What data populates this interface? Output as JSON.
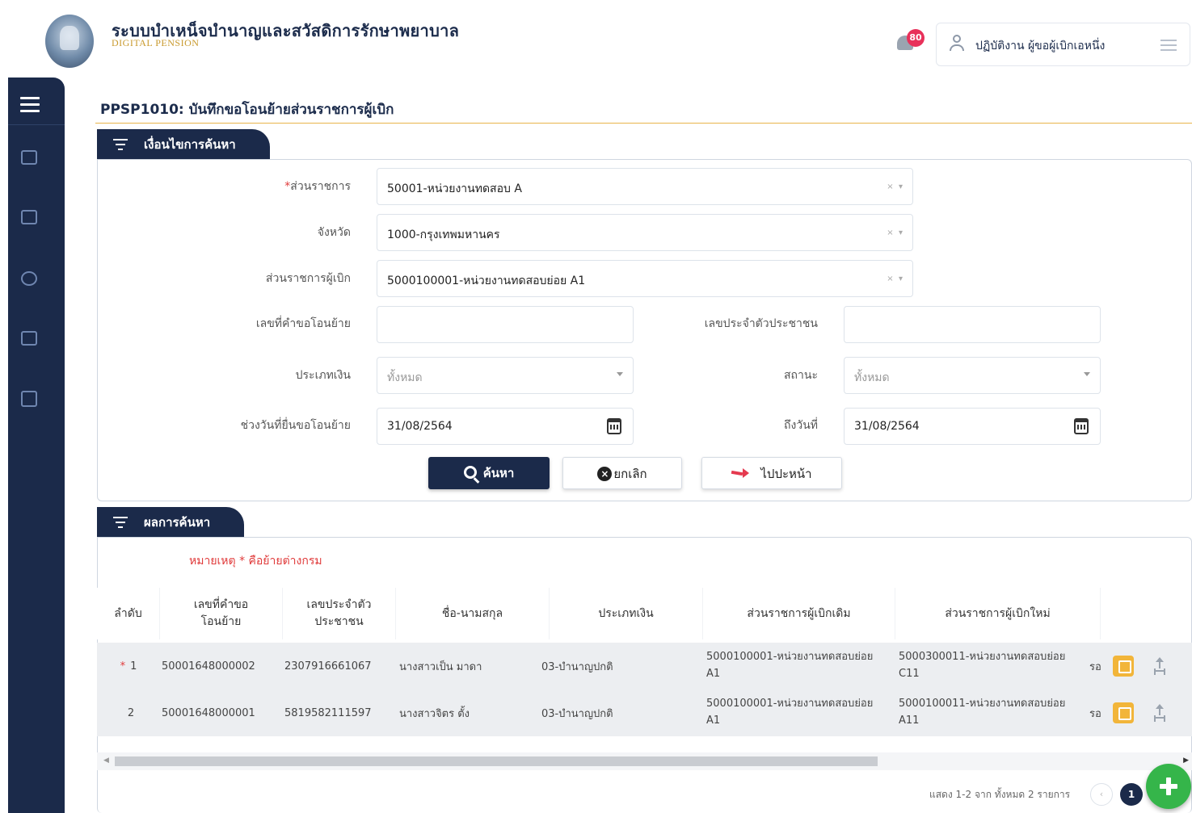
{
  "header": {
    "app_title": "ระบบบำเหน็จบำนาญและสวัสดิการรักษาพยาบาล",
    "app_subtitle": "DIGITAL PENSION",
    "notification_count": "80",
    "user_label": "ปฏิบัติงาน ผู้ขอผู้เบิกเอหนึ่ง"
  },
  "page": {
    "title": "PPSP1010: บันทึกขอโอนย้ายส่วนราชการผู้เบิก"
  },
  "search_section": {
    "title": "เงื่อนไขการค้นหา",
    "fields": {
      "agency": {
        "label": "ส่วนราชการ",
        "required_mark": "*",
        "value": "50001-หน่วยงานทดสอบ A"
      },
      "province": {
        "label": "จังหวัด",
        "value": "1000-กรุงเทพมหานคร"
      },
      "disbursing_agency": {
        "label": "ส่วนราชการผู้เบิก",
        "value": "5000100001-หน่วยงานทดสอบย่อย A1"
      },
      "request_no": {
        "label": "เลขที่คำขอโอนย้าย",
        "value": ""
      },
      "citizen_id": {
        "label": "เลขประจำตัวประชาชน",
        "value": ""
      },
      "payment_type": {
        "label": "ประเภทเงิน",
        "value": "ทั้งหมด"
      },
      "status": {
        "label": "สถานะ",
        "value": "ทั้งหมด"
      },
      "date_from": {
        "label": "ช่วงวันที่ยื่นขอโอนย้าย",
        "value": "31/08/2564"
      },
      "date_to": {
        "label": "ถึงวันที่",
        "value": "31/08/2564"
      }
    },
    "buttons": {
      "search": "ค้นหา",
      "cancel": "ยกเลิก",
      "forward": "ไปปะหน้า"
    }
  },
  "results_section": {
    "title": "ผลการค้นหา",
    "note": "หมายเหตุ * คือย้ายต่างกรม",
    "columns": [
      "ลำดับ",
      "เลขที่คำขอโอนย้าย",
      "เลขประจำตัวประชาชน",
      "ชื่อ-นามสกุล",
      "ประเภทเงิน",
      "ส่วนราชการผู้เบิกเดิม",
      "ส่วนราชการผู้เบิกใหม่"
    ],
    "rows": [
      {
        "mark": "*",
        "no": "1",
        "request_no": "50001648000002",
        "citizen_id": "2307916661067",
        "name": "นางสาวเป็น มาดา",
        "type": "03-บำนาญปกติ",
        "old_agency_1": "5000100001-หน่วยงานทดสอบย่อย",
        "old_agency_2": "A1",
        "new_agency_1": "5000300011-หน่วยงานทดสอบย่อย",
        "new_agency_2": "C11",
        "extra": "รอ"
      },
      {
        "mark": "",
        "no": "2",
        "request_no": "50001648000001",
        "citizen_id": "5819582111597",
        "name": "นางสาวจิตร ตั้ง",
        "type": "03-บำนาญปกติ",
        "old_agency_1": "5000100001-หน่วยงานทดสอบย่อย",
        "old_agency_2": "A1",
        "new_agency_1": "5000100011-หน่วยงานทดสอบย่อย",
        "new_agency_2": "A11",
        "extra": "รอ"
      }
    ],
    "pagination": {
      "summary": "แสดง 1-2 จาก ทั้งหมด 2 รายการ",
      "current_page": "1"
    },
    "scrollbar": {
      "visible_fraction": 0.72
    }
  },
  "colors": {
    "navy": "#1b2a4a",
    "accent_gold": "#e8b54a",
    "danger": "#e03a3a",
    "add": "#35b54a",
    "edit": "#f2b53a"
  }
}
